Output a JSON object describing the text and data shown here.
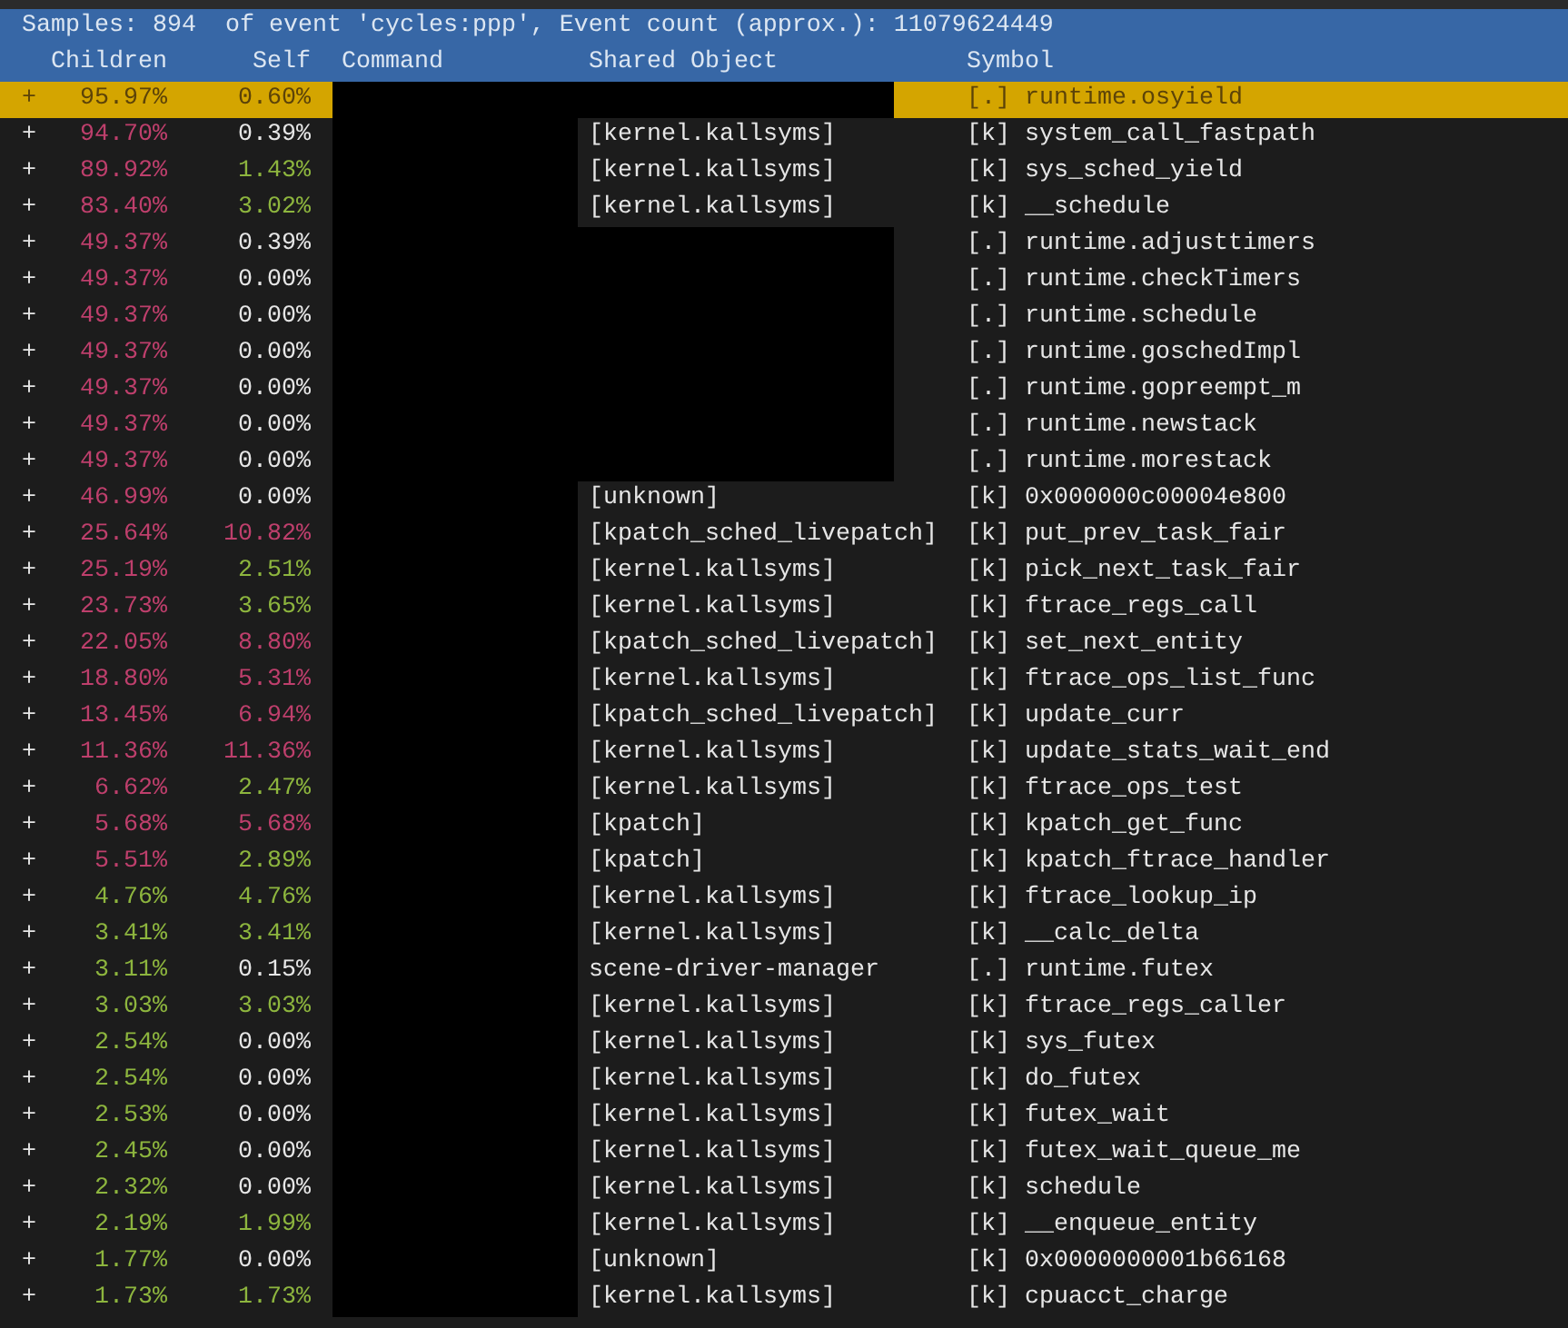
{
  "summary": "Samples: 894  of event 'cycles:ppp', Event count (approx.): 11079624449",
  "columns": [
    "Children",
    "Self",
    "Command",
    "Shared Object",
    "Symbol"
  ],
  "rows": [
    {
      "expander": "+",
      "children": {
        "text": "95.97%",
        "color": "#5c4308"
      },
      "self": {
        "text": "0.60%",
        "color": "#5c4308"
      },
      "command_hidden": true,
      "shared_object_hidden": true,
      "symbol": "[.] runtime.osyield",
      "selected": true
    },
    {
      "expander": "+",
      "children": {
        "text": "94.70%",
        "color": "#be3f6c"
      },
      "self": {
        "text": "0.39%",
        "color": "#e6e6e6"
      },
      "command_hidden": true,
      "shared_object": "[kernel.kallsyms]",
      "shared_object_hidden": false,
      "symbol": "[k] system_call_fastpath",
      "selected": false
    },
    {
      "expander": "+",
      "children": {
        "text": "89.92%",
        "color": "#be3f6c"
      },
      "self": {
        "text": "1.43%",
        "color": "#8db53e"
      },
      "command_hidden": true,
      "shared_object": "[kernel.kallsyms]",
      "shared_object_hidden": false,
      "symbol": "[k] sys_sched_yield",
      "selected": false
    },
    {
      "expander": "+",
      "children": {
        "text": "83.40%",
        "color": "#be3f6c"
      },
      "self": {
        "text": "3.02%",
        "color": "#8db53e"
      },
      "command_hidden": true,
      "shared_object": "[kernel.kallsyms]",
      "shared_object_hidden": false,
      "symbol": "[k] __schedule",
      "selected": false
    },
    {
      "expander": "+",
      "children": {
        "text": "49.37%",
        "color": "#be3f6c"
      },
      "self": {
        "text": "0.39%",
        "color": "#e6e6e6"
      },
      "command_hidden": true,
      "shared_object_hidden": true,
      "symbol": "[.] runtime.adjusttimers",
      "selected": false
    },
    {
      "expander": "+",
      "children": {
        "text": "49.37%",
        "color": "#be3f6c"
      },
      "self": {
        "text": "0.00%",
        "color": "#e6e6e6"
      },
      "command_hidden": true,
      "shared_object_hidden": true,
      "symbol": "[.] runtime.checkTimers",
      "selected": false
    },
    {
      "expander": "+",
      "children": {
        "text": "49.37%",
        "color": "#be3f6c"
      },
      "self": {
        "text": "0.00%",
        "color": "#e6e6e6"
      },
      "command_hidden": true,
      "shared_object_hidden": true,
      "symbol": "[.] runtime.schedule",
      "selected": false
    },
    {
      "expander": "+",
      "children": {
        "text": "49.37%",
        "color": "#be3f6c"
      },
      "self": {
        "text": "0.00%",
        "color": "#e6e6e6"
      },
      "command_hidden": true,
      "shared_object_hidden": true,
      "symbol": "[.] runtime.goschedImpl",
      "selected": false
    },
    {
      "expander": "+",
      "children": {
        "text": "49.37%",
        "color": "#be3f6c"
      },
      "self": {
        "text": "0.00%",
        "color": "#e6e6e6"
      },
      "command_hidden": true,
      "shared_object_hidden": true,
      "symbol": "[.] runtime.gopreempt_m",
      "selected": false
    },
    {
      "expander": "+",
      "children": {
        "text": "49.37%",
        "color": "#be3f6c"
      },
      "self": {
        "text": "0.00%",
        "color": "#e6e6e6"
      },
      "command_hidden": true,
      "shared_object_hidden": true,
      "symbol": "[.] runtime.newstack",
      "selected": false
    },
    {
      "expander": "+",
      "children": {
        "text": "49.37%",
        "color": "#be3f6c"
      },
      "self": {
        "text": "0.00%",
        "color": "#e6e6e6"
      },
      "command_hidden": true,
      "shared_object_hidden": true,
      "symbol": "[.] runtime.morestack",
      "selected": false
    },
    {
      "expander": "+",
      "children": {
        "text": "46.99%",
        "color": "#be3f6c"
      },
      "self": {
        "text": "0.00%",
        "color": "#e6e6e6"
      },
      "command_hidden": true,
      "shared_object": "[unknown]",
      "shared_object_hidden": false,
      "symbol": "[k] 0x000000c00004e800",
      "selected": false
    },
    {
      "expander": "+",
      "children": {
        "text": "25.64%",
        "color": "#be3f6c"
      },
      "self": {
        "text": "10.82%",
        "color": "#be3f6c"
      },
      "command_hidden": true,
      "shared_object": "[kpatch_sched_livepatch]",
      "shared_object_hidden": false,
      "symbol": "[k] put_prev_task_fair",
      "selected": false
    },
    {
      "expander": "+",
      "children": {
        "text": "25.19%",
        "color": "#be3f6c"
      },
      "self": {
        "text": "2.51%",
        "color": "#8db53e"
      },
      "command_hidden": true,
      "shared_object": "[kernel.kallsyms]",
      "shared_object_hidden": false,
      "symbol": "[k] pick_next_task_fair",
      "selected": false
    },
    {
      "expander": "+",
      "children": {
        "text": "23.73%",
        "color": "#be3f6c"
      },
      "self": {
        "text": "3.65%",
        "color": "#8db53e"
      },
      "command_hidden": true,
      "shared_object": "[kernel.kallsyms]",
      "shared_object_hidden": false,
      "symbol": "[k] ftrace_regs_call",
      "selected": false
    },
    {
      "expander": "+",
      "children": {
        "text": "22.05%",
        "color": "#be3f6c"
      },
      "self": {
        "text": "8.80%",
        "color": "#be3f6c"
      },
      "command_hidden": true,
      "shared_object": "[kpatch_sched_livepatch]",
      "shared_object_hidden": false,
      "symbol": "[k] set_next_entity",
      "selected": false
    },
    {
      "expander": "+",
      "children": {
        "text": "18.80%",
        "color": "#be3f6c"
      },
      "self": {
        "text": "5.31%",
        "color": "#be3f6c"
      },
      "command_hidden": true,
      "shared_object": "[kernel.kallsyms]",
      "shared_object_hidden": false,
      "symbol": "[k] ftrace_ops_list_func",
      "selected": false
    },
    {
      "expander": "+",
      "children": {
        "text": "13.45%",
        "color": "#be3f6c"
      },
      "self": {
        "text": "6.94%",
        "color": "#be3f6c"
      },
      "command_hidden": true,
      "shared_object": "[kpatch_sched_livepatch]",
      "shared_object_hidden": false,
      "symbol": "[k] update_curr",
      "selected": false
    },
    {
      "expander": "+",
      "children": {
        "text": "11.36%",
        "color": "#be3f6c"
      },
      "self": {
        "text": "11.36%",
        "color": "#be3f6c"
      },
      "command_hidden": true,
      "shared_object": "[kernel.kallsyms]",
      "shared_object_hidden": false,
      "symbol": "[k] update_stats_wait_end",
      "selected": false
    },
    {
      "expander": "+",
      "children": {
        "text": "6.62%",
        "color": "#be3f6c"
      },
      "self": {
        "text": "2.47%",
        "color": "#8db53e"
      },
      "command_hidden": true,
      "shared_object": "[kernel.kallsyms]",
      "shared_object_hidden": false,
      "symbol": "[k] ftrace_ops_test",
      "selected": false
    },
    {
      "expander": "+",
      "children": {
        "text": "5.68%",
        "color": "#be3f6c"
      },
      "self": {
        "text": "5.68%",
        "color": "#be3f6c"
      },
      "command_hidden": true,
      "shared_object": "[kpatch]",
      "shared_object_hidden": false,
      "symbol": "[k] kpatch_get_func",
      "selected": false
    },
    {
      "expander": "+",
      "children": {
        "text": "5.51%",
        "color": "#be3f6c"
      },
      "self": {
        "text": "2.89%",
        "color": "#8db53e"
      },
      "command_hidden": true,
      "shared_object": "[kpatch]",
      "shared_object_hidden": false,
      "symbol": "[k] kpatch_ftrace_handler",
      "selected": false
    },
    {
      "expander": "+",
      "children": {
        "text": "4.76%",
        "color": "#8db53e"
      },
      "self": {
        "text": "4.76%",
        "color": "#8db53e"
      },
      "command_hidden": true,
      "shared_object": "[kernel.kallsyms]",
      "shared_object_hidden": false,
      "symbol": "[k] ftrace_lookup_ip",
      "selected": false
    },
    {
      "expander": "+",
      "children": {
        "text": "3.41%",
        "color": "#8db53e"
      },
      "self": {
        "text": "3.41%",
        "color": "#8db53e"
      },
      "command_hidden": true,
      "shared_object": "[kernel.kallsyms]",
      "shared_object_hidden": false,
      "symbol": "[k] __calc_delta",
      "selected": false
    },
    {
      "expander": "+",
      "children": {
        "text": "3.11%",
        "color": "#8db53e"
      },
      "self": {
        "text": "0.15%",
        "color": "#e6e6e6"
      },
      "command_hidden": true,
      "shared_object": "scene-driver-manager",
      "shared_object_hidden": false,
      "symbol": "[.] runtime.futex",
      "selected": false
    },
    {
      "expander": "+",
      "children": {
        "text": "3.03%",
        "color": "#8db53e"
      },
      "self": {
        "text": "3.03%",
        "color": "#8db53e"
      },
      "command_hidden": true,
      "shared_object": "[kernel.kallsyms]",
      "shared_object_hidden": false,
      "symbol": "[k] ftrace_regs_caller",
      "selected": false
    },
    {
      "expander": "+",
      "children": {
        "text": "2.54%",
        "color": "#8db53e"
      },
      "self": {
        "text": "0.00%",
        "color": "#e6e6e6"
      },
      "command_hidden": true,
      "shared_object": "[kernel.kallsyms]",
      "shared_object_hidden": false,
      "symbol": "[k] sys_futex",
      "selected": false
    },
    {
      "expander": "+",
      "children": {
        "text": "2.54%",
        "color": "#8db53e"
      },
      "self": {
        "text": "0.00%",
        "color": "#e6e6e6"
      },
      "command_hidden": true,
      "shared_object": "[kernel.kallsyms]",
      "shared_object_hidden": false,
      "symbol": "[k] do_futex",
      "selected": false
    },
    {
      "expander": "+",
      "children": {
        "text": "2.53%",
        "color": "#8db53e"
      },
      "self": {
        "text": "0.00%",
        "color": "#e6e6e6"
      },
      "command_hidden": true,
      "shared_object": "[kernel.kallsyms]",
      "shared_object_hidden": false,
      "symbol": "[k] futex_wait",
      "selected": false
    },
    {
      "expander": "+",
      "children": {
        "text": "2.45%",
        "color": "#8db53e"
      },
      "self": {
        "text": "0.00%",
        "color": "#e6e6e6"
      },
      "command_hidden": true,
      "shared_object": "[kernel.kallsyms]",
      "shared_object_hidden": false,
      "symbol": "[k] futex_wait_queue_me",
      "selected": false
    },
    {
      "expander": "+",
      "children": {
        "text": "2.32%",
        "color": "#8db53e"
      },
      "self": {
        "text": "0.00%",
        "color": "#e6e6e6"
      },
      "command_hidden": true,
      "shared_object": "[kernel.kallsyms]",
      "shared_object_hidden": false,
      "symbol": "[k] schedule",
      "selected": false
    },
    {
      "expander": "+",
      "children": {
        "text": "2.19%",
        "color": "#8db53e"
      },
      "self": {
        "text": "1.99%",
        "color": "#8db53e"
      },
      "command_hidden": true,
      "shared_object": "[kernel.kallsyms]",
      "shared_object_hidden": false,
      "symbol": "[k] __enqueue_entity",
      "selected": false
    },
    {
      "expander": "+",
      "children": {
        "text": "1.77%",
        "color": "#8db53e"
      },
      "self": {
        "text": "0.00%",
        "color": "#e6e6e6"
      },
      "command_hidden": true,
      "shared_object": "[unknown]",
      "shared_object_hidden": false,
      "symbol": "[k] 0x0000000001b66168",
      "selected": false
    },
    {
      "expander": "+",
      "children": {
        "text": "1.73%",
        "color": "#8db53e"
      },
      "self": {
        "text": "1.73%",
        "color": "#8db53e"
      },
      "command_hidden": true,
      "shared_object": "[kernel.kallsyms]",
      "shared_object_hidden": false,
      "symbol": "[k] cpuacct_charge",
      "selected": false
    }
  ]
}
